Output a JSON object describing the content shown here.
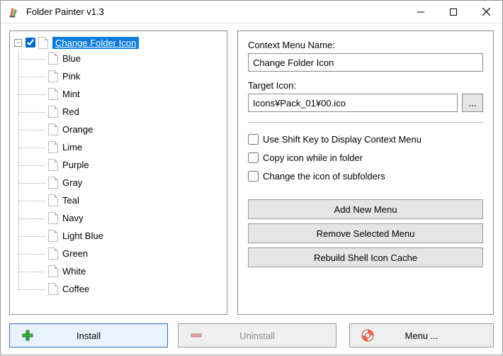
{
  "window": {
    "title": "Folder Painter v1.3"
  },
  "tree": {
    "root_label": "Change Folder Icon",
    "root_checked": true,
    "items": [
      "Blue",
      "Pink",
      "Mint",
      "Red",
      "Orange",
      "Lime",
      "Purple",
      "Gray",
      "Teal",
      "Navy",
      "Light Blue",
      "Green",
      "White",
      "Coffee"
    ]
  },
  "right": {
    "context_menu_label": "Context Menu Name:",
    "context_menu_value": "Change Folder Icon",
    "target_icon_label": "Target Icon:",
    "target_icon_value": "Icons¥Pack_01¥00.ico",
    "browse_label": "...",
    "checks": {
      "shift": "Use Shift Key to Display Context Menu",
      "copy": "Copy icon while in folder",
      "subfolders": "Change the icon of subfolders"
    },
    "buttons": {
      "add": "Add New Menu",
      "remove": "Remove Selected Menu",
      "rebuild": "Rebuild Shell Icon Cache"
    }
  },
  "bottom": {
    "install": "Install",
    "uninstall": "Uninstall",
    "menu": "Menu ..."
  }
}
